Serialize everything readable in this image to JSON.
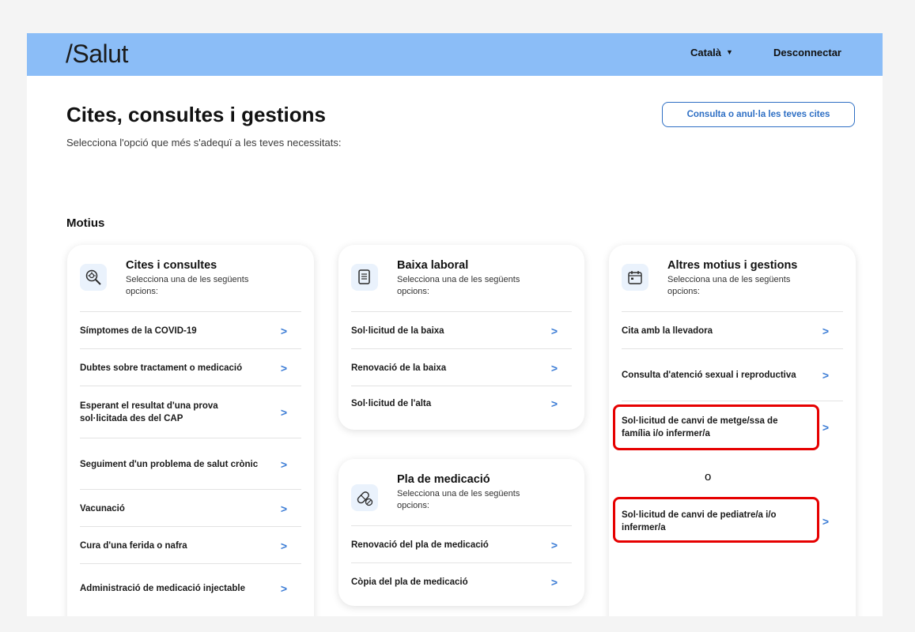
{
  "header": {
    "logo": "/Salut",
    "language": "Català",
    "logout": "Desconnectar"
  },
  "page": {
    "title": "Cites, consultes i gestions",
    "subtitle": "Selecciona l'opció que més s'adequï a les teves necessitats:",
    "appointments_button": "Consulta o anul·la les teves cites",
    "section_title": "Motius"
  },
  "cards": {
    "cites": {
      "title": "Cites i consultes",
      "desc": "Selecciona una de les següents opcions:",
      "icon": "search-virus-icon",
      "options": [
        "Símptomes de la COVID-19",
        "Dubtes sobre tractament o medicació",
        "Esperant el resultat d'una prova sol·licitada des del CAP",
        "Seguiment d'un problema de salut crònic",
        "Vacunació",
        "Cura d'una ferida o nafra",
        "Administració de medicació injectable"
      ]
    },
    "baixa": {
      "title": "Baixa laboral",
      "desc": "Selecciona una de les següents opcions:",
      "icon": "document-icon",
      "options": [
        "Sol·licitud de la baixa",
        "Renovació de la baixa",
        "Sol·licitud de l'alta"
      ]
    },
    "medicacio": {
      "title": "Pla de medicació",
      "desc": "Selecciona una de les següents opcions:",
      "icon": "pill-icon",
      "options": [
        "Renovació del pla de medicació",
        "Còpia del pla de medicació"
      ]
    },
    "altres": {
      "title": "Altres motius i gestions",
      "desc": "Selecciona una de les següents opcions:",
      "icon": "calendar-icon",
      "options": [
        "Cita amb la llevadora",
        "Consulta d'atenció sexual i reproductiva",
        "Sol·licitud de canvi de metge/ssa de família i/o infermer/a",
        "Sol·licitud de canvi de pediatre/a i/o infermer/a"
      ]
    }
  },
  "annotation": {
    "or": "o",
    "highlight_color": "#e60000"
  },
  "colors": {
    "header_bg": "#8bbdf7",
    "accent": "#2e6fc4"
  }
}
